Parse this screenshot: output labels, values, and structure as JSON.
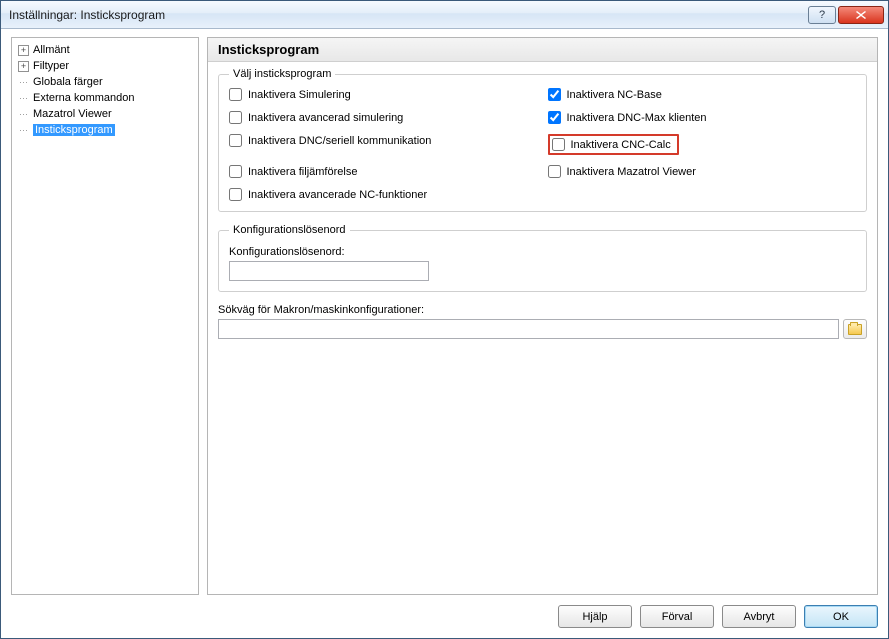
{
  "window": {
    "title": "Inställningar: Insticksprogram"
  },
  "tree": {
    "items": [
      {
        "label": "Allmänt",
        "expandable": true
      },
      {
        "label": "Filtyper",
        "expandable": true
      },
      {
        "label": "Globala färger",
        "expandable": false
      },
      {
        "label": "Externa kommandon",
        "expandable": false
      },
      {
        "label": "Mazatrol Viewer",
        "expandable": false
      },
      {
        "label": "Insticksprogram",
        "expandable": false,
        "selected": true
      }
    ]
  },
  "content": {
    "heading": "Insticksprogram",
    "group_select": {
      "legend": "Välj insticksprogram",
      "options": [
        {
          "label": "Inaktivera Simulering",
          "checked": false
        },
        {
          "label": "Inaktivera NC-Base",
          "checked": true
        },
        {
          "label": "Inaktivera avancerad simulering",
          "checked": false
        },
        {
          "label": "Inaktivera DNC-Max klienten",
          "checked": true
        },
        {
          "label": "Inaktivera DNC/seriell kommunikation",
          "checked": false
        },
        {
          "label": "Inaktivera CNC-Calc",
          "checked": false,
          "highlight": true
        },
        {
          "label": "Inaktivera filjämförelse",
          "checked": false
        },
        {
          "label": "Inaktivera Mazatrol Viewer",
          "checked": false
        },
        {
          "label": "Inaktivera avancerade NC-funktioner",
          "checked": false
        }
      ]
    },
    "group_password": {
      "legend": "Konfigurationslösenord",
      "field_label": "Konfigurationslösenord:",
      "value": ""
    },
    "group_path": {
      "label": "Sökväg för Makron/maskinkonfigurationer:",
      "value": ""
    }
  },
  "buttons": {
    "help": "Hjälp",
    "defaults": "Förval",
    "cancel": "Avbryt",
    "ok": "OK"
  }
}
